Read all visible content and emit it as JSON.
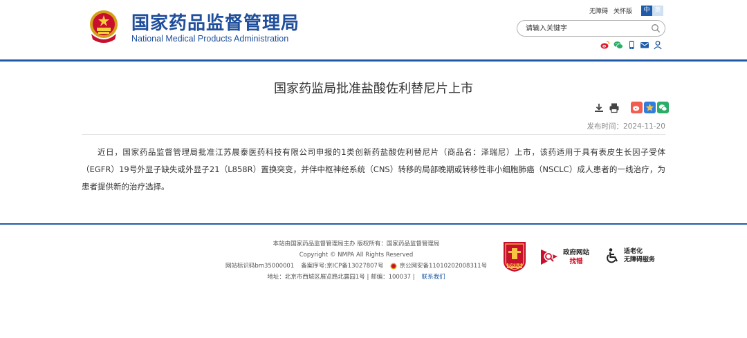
{
  "header": {
    "brand_cn": "国家药品监督管理局",
    "brand_en": "National Medical Products Administration",
    "top_links": [
      "无障碍",
      "关怀版"
    ],
    "lang": {
      "active": "中",
      "other": "英"
    },
    "search": {
      "placeholder": "请输入关键字"
    },
    "share_icons": [
      "weibo-icon",
      "wechat-icon",
      "mobile-icon",
      "mail-icon",
      "user-icon"
    ]
  },
  "article": {
    "title": "国家药监局批准盐酸佐利替尼片上市",
    "publish_date": "发布时间：2024-11-20",
    "tool_icons": [
      "download-icon",
      "print-icon",
      "weibo-share-icon",
      "favorite-icon",
      "wechat-share-icon"
    ],
    "content": "近日，国家药品监督管理局批准江苏晨泰医药科技有限公司申报的1类创新药盐酸佐利替尼片（商品名：泽瑞尼）上市，该药适用于具有表皮生长因子受体（EGFR）19号外显子缺失或外显子21（L858R）置换突变，并伴中枢神经系统（CNS）转移的局部晚期或转移性非小细胞肺癌（NSCLC）成人患者的一线治疗，为患者提供新的治疗选择。"
  },
  "footer": {
    "line1": "本站由国家药品监督管理局主办 版权所有：国家药品监督管理局",
    "line2": "Copyright © NMPA All Rights Reserved",
    "site_id": "网站标识码bm35000001",
    "icp": "备案序号:京ICP备13027807号",
    "police": "京公网安备11010202008311号",
    "address": "地址：北京市西城区展览路北露园1号 | 邮编：100037 |",
    "contact": "联系我们",
    "badge_gov_text": "党政机关",
    "jiucuo_line1": "政府网站",
    "jiucuo_line2": "找错",
    "accessibility_line1": "适老化",
    "accessibility_line2": "无障碍服务",
    "colors": {
      "primary": "#1f5ba8",
      "badge_red": "#c8102e"
    }
  }
}
